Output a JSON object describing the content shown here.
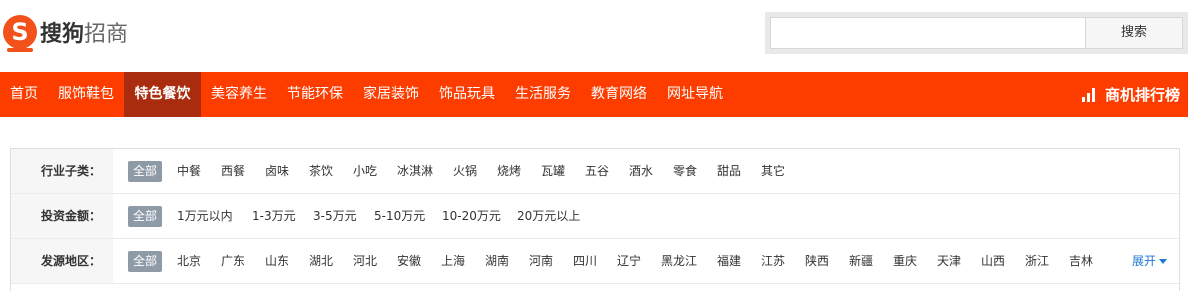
{
  "brand": {
    "logo_letter": "S",
    "name_bold": "搜狗",
    "name_rest": "招商"
  },
  "search": {
    "placeholder": "",
    "button_label": "搜索"
  },
  "nav": {
    "items": [
      "首页",
      "服饰鞋包",
      "特色餐饮",
      "美容养生",
      "节能环保",
      "家居装饰",
      "饰品玩具",
      "生活服务",
      "教育网络",
      "网址导航"
    ],
    "active": "特色餐饮",
    "rank_label": "商机排行榜"
  },
  "filters": [
    {
      "label": "行业子类：",
      "options": [
        "全部",
        "中餐",
        "西餐",
        "卤味",
        "茶饮",
        "小吃",
        "冰淇淋",
        "火锅",
        "烧烤",
        "瓦罐",
        "五谷",
        "酒水",
        "零食",
        "甜品",
        "其它"
      ]
    },
    {
      "label": "投资金额：",
      "options": [
        "全部",
        "1万元以内",
        "1-3万元",
        "3-5万元",
        "5-10万元",
        "10-20万元",
        "20万元以上"
      ]
    },
    {
      "label": "发源地区：",
      "options": [
        "全部",
        "北京",
        "广东",
        "山东",
        "湖北",
        "河北",
        "安徽",
        "上海",
        "湖南",
        "河南",
        "四川",
        "辽宁",
        "黑龙江",
        "福建",
        "江苏",
        "陕西",
        "新疆",
        "重庆",
        "天津",
        "山西",
        "浙江",
        "吉林"
      ],
      "expand_label": "展开"
    }
  ],
  "colors": {
    "nav_bg": "#fd3d00",
    "nav_active": "#a92c0e",
    "chip_selected": "#8f9aa7",
    "link": "#1f76d3"
  }
}
